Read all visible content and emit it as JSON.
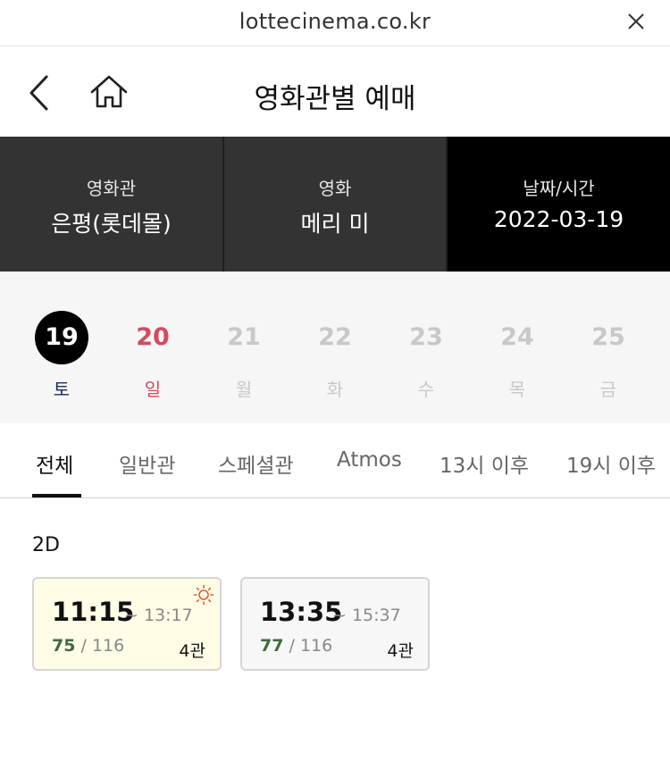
{
  "browser": {
    "url": "lottecinema.co.kr",
    "close_icon": "close-icon"
  },
  "header": {
    "title": "영화관별 예매",
    "back_icon": "chevron-left-icon",
    "home_icon": "home-icon"
  },
  "selector": {
    "theater": {
      "label": "영화관",
      "value": "은평(롯데몰)"
    },
    "movie": {
      "label": "영화",
      "value": "메리 미"
    },
    "datetime": {
      "label": "날짜/시간",
      "value": "2022-03-19"
    }
  },
  "dates": [
    {
      "day": "19",
      "weekday": "토",
      "state": "selected"
    },
    {
      "day": "20",
      "weekday": "일",
      "state": "sunday"
    },
    {
      "day": "21",
      "weekday": "월",
      "state": "disabled"
    },
    {
      "day": "22",
      "weekday": "화",
      "state": "disabled"
    },
    {
      "day": "23",
      "weekday": "수",
      "state": "disabled"
    },
    {
      "day": "24",
      "weekday": "목",
      "state": "disabled"
    },
    {
      "day": "25",
      "weekday": "금",
      "state": "disabled"
    }
  ],
  "tabs": [
    {
      "label": "전체",
      "active": true
    },
    {
      "label": "일반관",
      "active": false
    },
    {
      "label": "스페셜관",
      "active": false
    },
    {
      "label": "Atmos",
      "active": false
    },
    {
      "label": "13시 이후",
      "active": false
    },
    {
      "label": "19시 이후",
      "active": false
    }
  ],
  "format": "2D",
  "showtimes": [
    {
      "start": "11:15",
      "separator": "~",
      "end": "13:17",
      "available": "75",
      "total": "/ 116",
      "hall": "4관",
      "morning": true,
      "icon": "sun-icon"
    },
    {
      "start": "13:35",
      "separator": "~",
      "end": "15:37",
      "available": "77",
      "total": "/ 116",
      "hall": "4관",
      "morning": false
    }
  ],
  "colors": {
    "sunday": "#d24b5e",
    "saturday": "#1d2a6b",
    "seats_available": "#3e6b3e",
    "morning_bg": "#fffde6",
    "morning_icon": "#e0603a"
  }
}
